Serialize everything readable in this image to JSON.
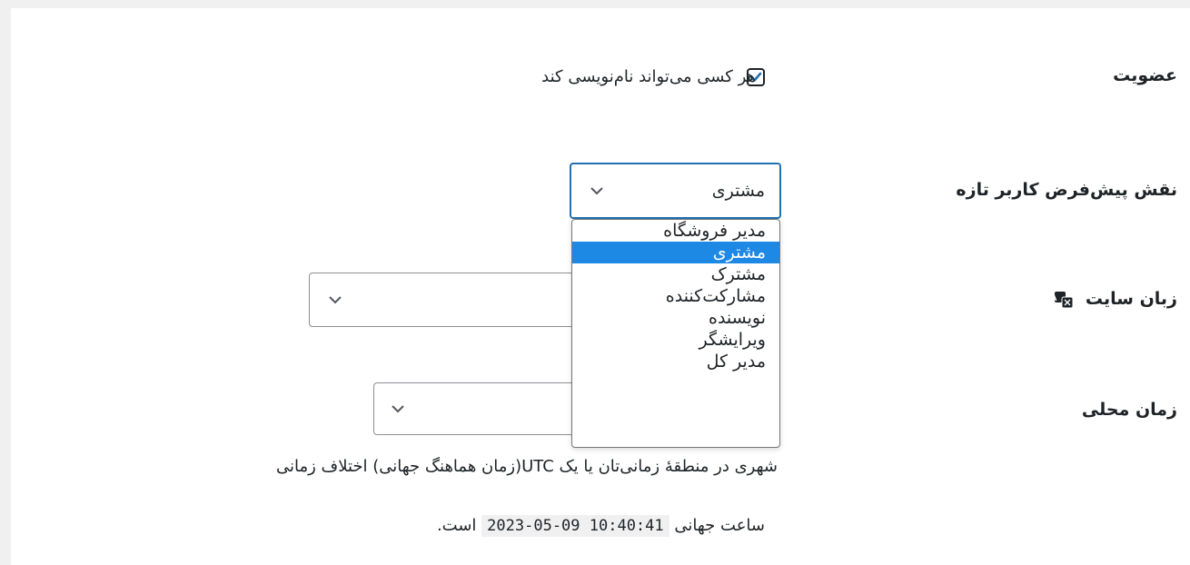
{
  "membership": {
    "label": "عضویت",
    "checkbox_label": "هر کسی می‌تواند نام‌نویسی کند",
    "checked": true
  },
  "default_role": {
    "label": "نقش پیش‌فرض کاربر تازه",
    "selected": "مشتری",
    "options": [
      "مدیر فروشگاه",
      "مشتری",
      "مشترک",
      "مشارکت‌کننده",
      "نویسنده",
      "ویرایشگر",
      "مدیر کل"
    ],
    "selected_index": 1
  },
  "site_language": {
    "label": "زبان سایت",
    "icon": "translation-icon"
  },
  "timezone": {
    "label": "زمان محلی",
    "description": "شهری در منطقهٔ زمانی‌تان یا یک UTC(زمان هماهنگ جهانی) اختلاف زمانی",
    "utc_prefix": "ساعت جهانی",
    "utc_time": "2023-05-09 10:40:41",
    "utc_suffix": "است."
  },
  "colors": {
    "accent": "#2271b1",
    "highlight": "#1e88e5",
    "background": "#f0f0f1"
  }
}
